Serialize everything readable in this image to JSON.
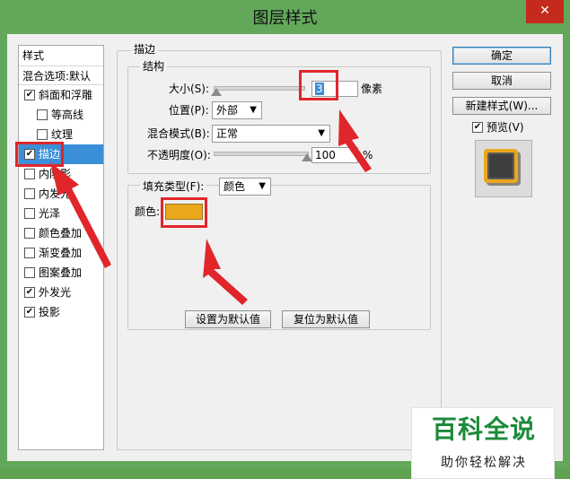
{
  "window": {
    "title": "图层样式",
    "close_glyph": "✕"
  },
  "style_list": {
    "header": "样式",
    "blend_options": "混合选项:默认",
    "items": [
      {
        "label": "斜面和浮雕",
        "checked": true,
        "indent": false
      },
      {
        "label": "等高线",
        "checked": false,
        "indent": true
      },
      {
        "label": "纹理",
        "checked": false,
        "indent": true
      },
      {
        "label": "描边",
        "checked": true,
        "indent": false,
        "selected": true
      },
      {
        "label": "内阴影",
        "checked": false,
        "indent": false
      },
      {
        "label": "内发光",
        "checked": false,
        "indent": false
      },
      {
        "label": "光泽",
        "checked": false,
        "indent": false
      },
      {
        "label": "颜色叠加",
        "checked": false,
        "indent": false
      },
      {
        "label": "渐变叠加",
        "checked": false,
        "indent": false
      },
      {
        "label": "图案叠加",
        "checked": false,
        "indent": false
      },
      {
        "label": "外发光",
        "checked": true,
        "indent": false
      },
      {
        "label": "投影",
        "checked": true,
        "indent": false
      }
    ]
  },
  "stroke": {
    "section_title": "描边",
    "structure_title": "结构",
    "size_label": "大小(S):",
    "size_value": "3",
    "size_unit": "像素",
    "position_label": "位置(P):",
    "position_value": "外部",
    "blend_mode_label": "混合模式(B):",
    "blend_mode_value": "正常",
    "opacity_label": "不透明度(O):",
    "opacity_value": "100",
    "opacity_unit": "%",
    "fill_type_label": "填充类型(F):",
    "fill_type_value": "颜色",
    "color_label": "颜色:",
    "color_hex": "#e8a71c",
    "make_default": "设置为默认值",
    "reset_default": "复位为默认值"
  },
  "right_panel": {
    "ok": "确定",
    "cancel": "取消",
    "new_style": "新建样式(W)...",
    "preview_label": "预览(V)",
    "preview_checked": true
  },
  "watermark": {
    "title": "百科全说",
    "subtitle": "助你轻松解决"
  },
  "annotation_color": "#e0262b"
}
